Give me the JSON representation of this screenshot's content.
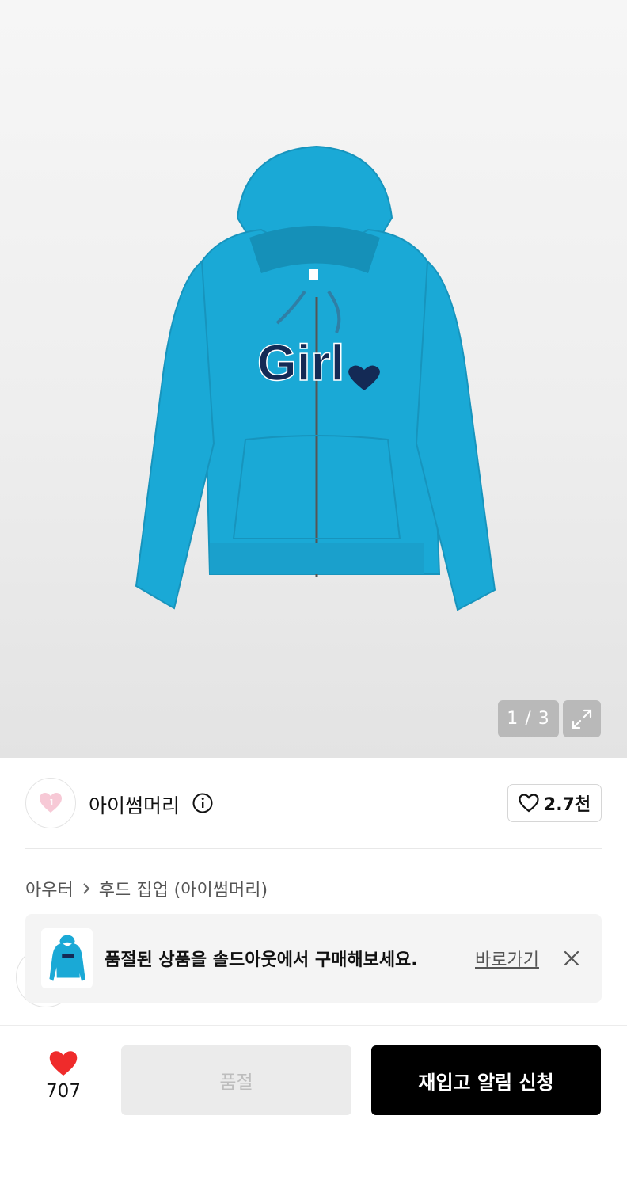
{
  "gallery": {
    "current_page": "1",
    "total_pages": "3",
    "page_counter": "1 / 3",
    "print_text": "Girl"
  },
  "brand": {
    "name": "아이썸머리",
    "like_count": "2.7천"
  },
  "breadcrumb": {
    "category": "아우터",
    "subcategory": "후드 집업 (아이썸머리)"
  },
  "banner": {
    "message": "품절된 상품을 솔드아웃에서 구매해보세요.",
    "link_label": "바로가기"
  },
  "bottom_bar": {
    "wish_count": "707",
    "soldout_label": "품절",
    "restock_label": "재입고 알림 신청"
  },
  "colors": {
    "hoodie": "#1aa9d6",
    "print_navy": "#142a55",
    "like_red": "#ef2b2b",
    "primary_black": "#000000"
  },
  "icons": [
    "expand-icon",
    "info-icon",
    "heart-outline-icon",
    "heart-filled-icon",
    "close-icon",
    "chevron-right-icon",
    "brand-heart-logo"
  ]
}
